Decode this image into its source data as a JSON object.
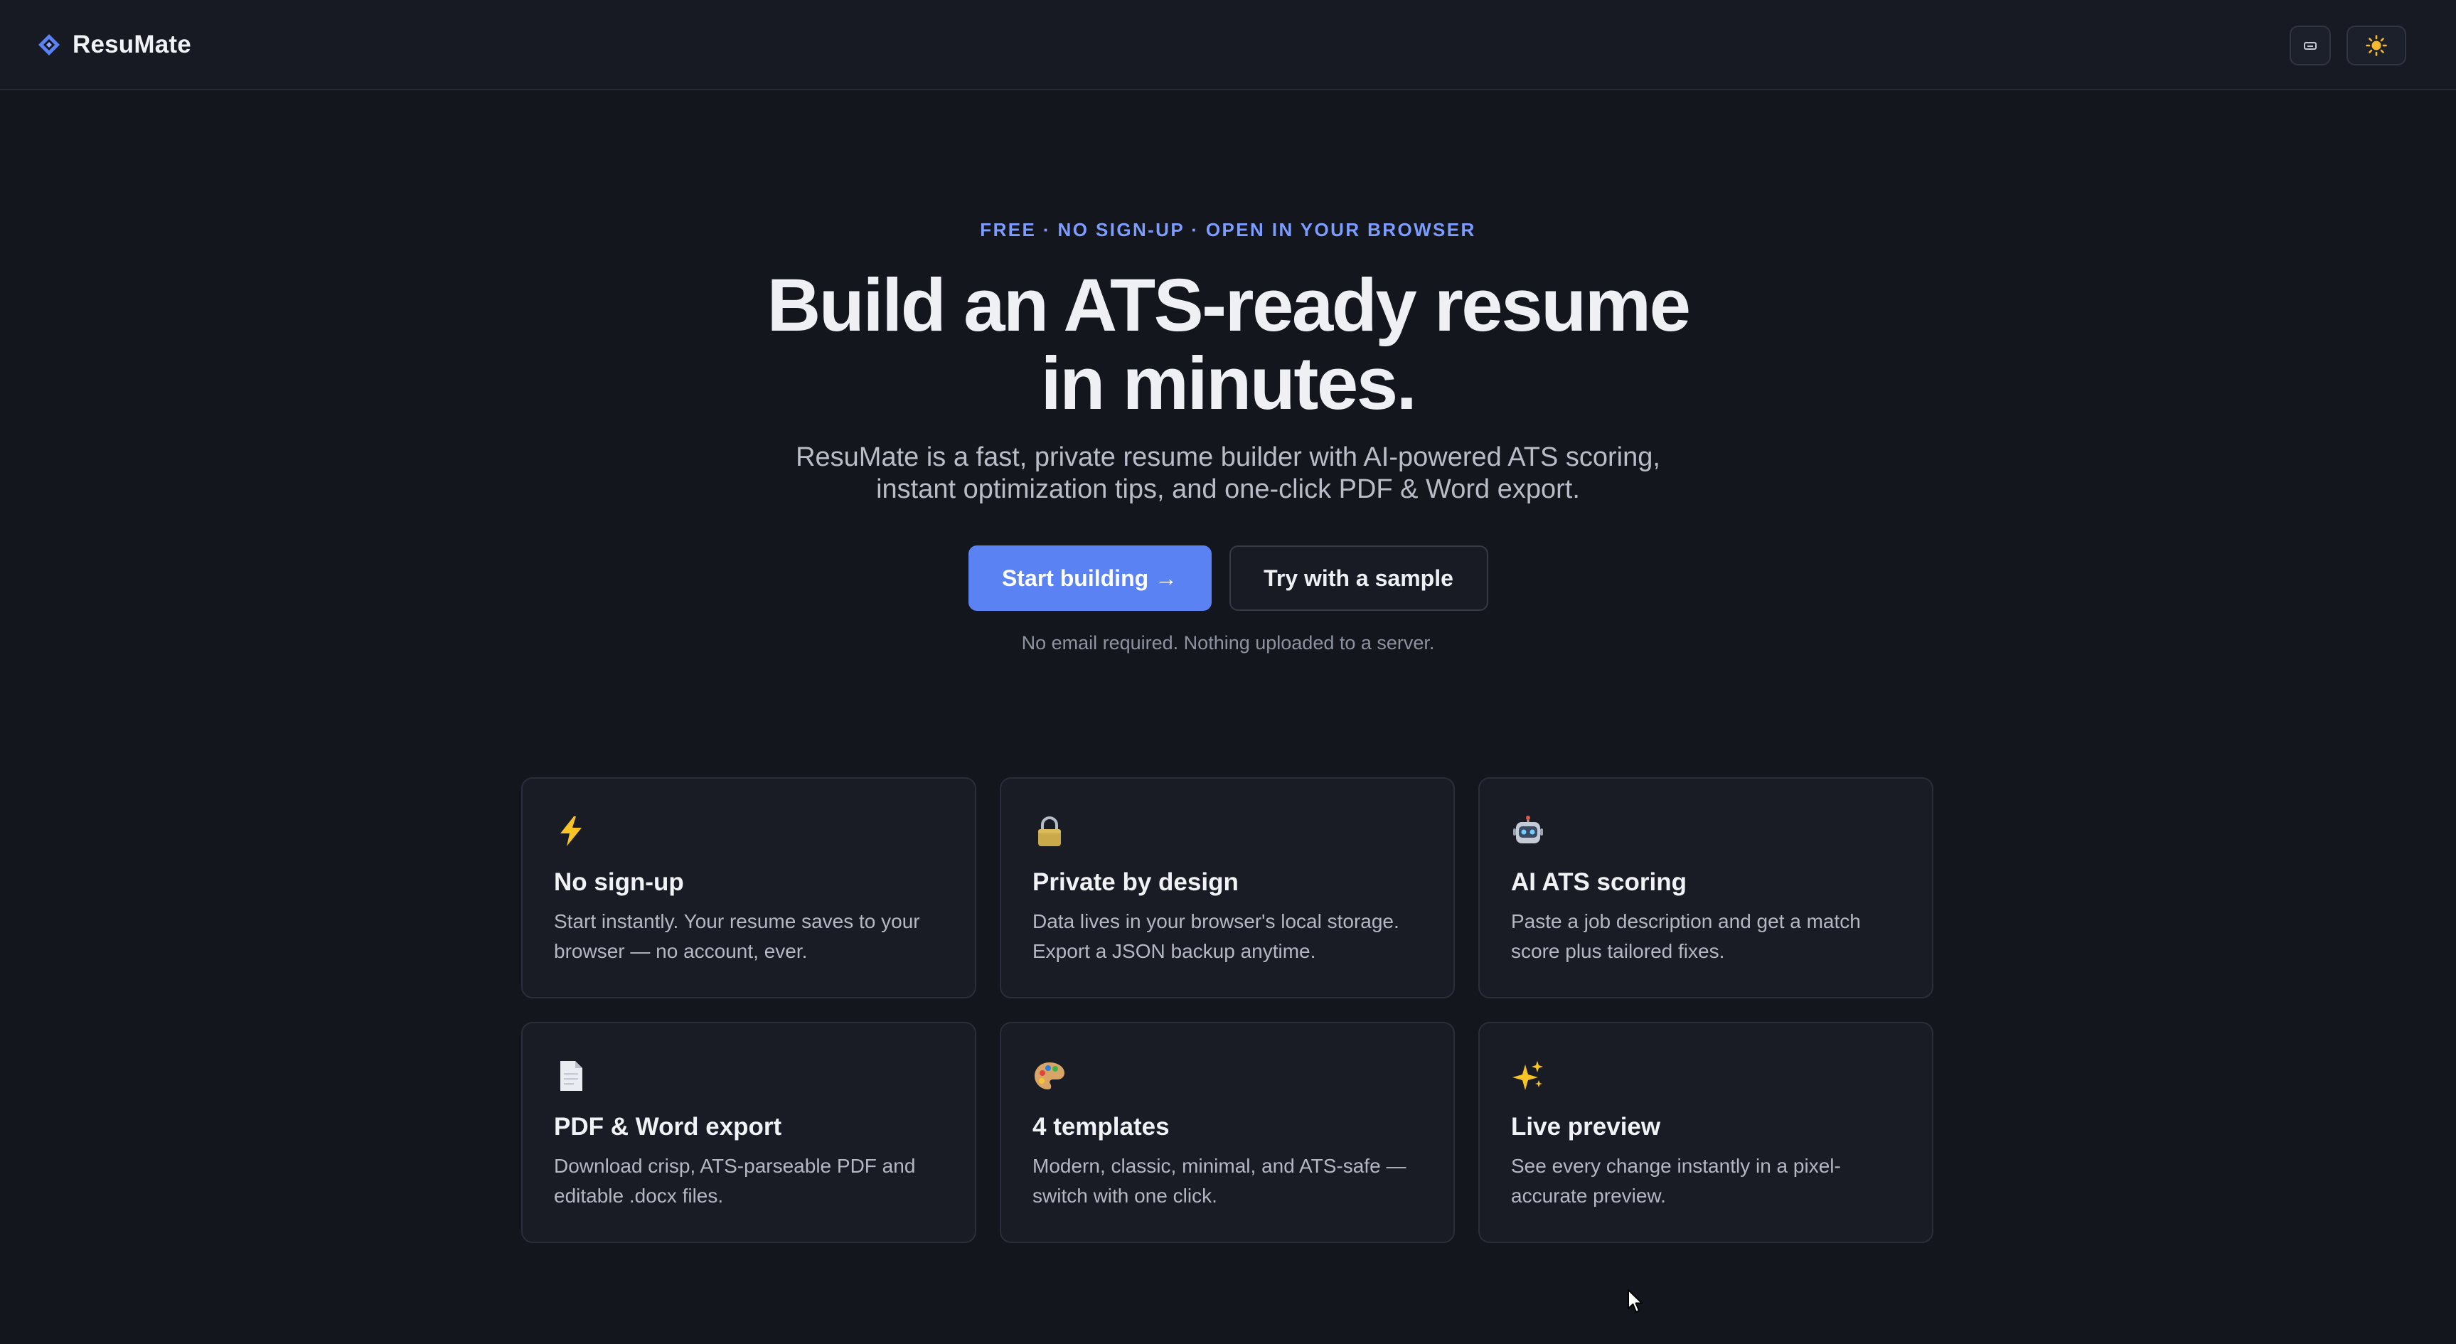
{
  "header": {
    "brand_name": "ResuMate",
    "keyboard_icon": "keyboard-icon",
    "theme_icon": "sun-icon"
  },
  "hero": {
    "eyebrow": "FREE · NO SIGN-UP · OPEN IN YOUR BROWSER",
    "headline_line1": "Build an ATS-ready resume",
    "headline_line2": "in minutes.",
    "subhead_line1": "ResuMate is a fast, private resume builder with AI-powered ATS scoring,",
    "subhead_line2": "instant optimization tips, and one-click PDF & Word export.",
    "primary_cta": "Start building →",
    "secondary_cta": "Try with a sample",
    "note": "No email required. Nothing uploaded to a server."
  },
  "features": [
    {
      "icon": "lightning-icon",
      "title": "No sign-up",
      "desc_line1": "Start instantly. Your resume saves to your",
      "desc_line2": "browser — no account, ever."
    },
    {
      "icon": "lock-icon",
      "title": "Private by design",
      "desc_line1": "Data lives in your browser's local storage.",
      "desc_line2": "Export a JSON backup anytime."
    },
    {
      "icon": "robot-icon",
      "title": "AI ATS scoring",
      "desc_line1": "Paste a job description and get a match",
      "desc_line2": "score plus tailored fixes."
    },
    {
      "icon": "document-icon",
      "title": "PDF & Word export",
      "desc_line1": "Download crisp, ATS-parseable PDF and",
      "desc_line2": "editable .docx files."
    },
    {
      "icon": "palette-icon",
      "title": "4 templates",
      "desc_line1": "Modern, classic, minimal, and ATS-safe —",
      "desc_line2": "switch with one click."
    },
    {
      "icon": "sparkles-icon",
      "title": "Live preview",
      "desc_line1": "See every change instantly in a pixel-",
      "desc_line2": "accurate preview."
    }
  ],
  "colors": {
    "background": "#13161d",
    "accent": "#5b82f2",
    "eyebrow": "#7c9cff",
    "card": "#191c25"
  }
}
